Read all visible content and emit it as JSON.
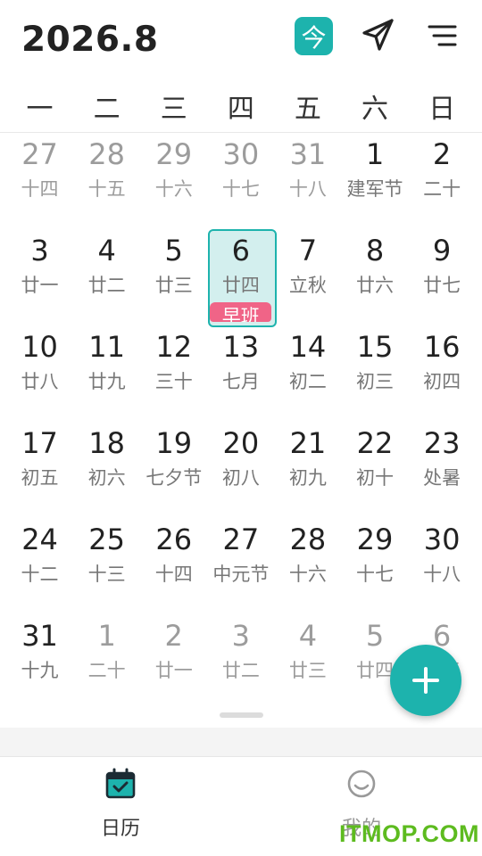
{
  "header": {
    "title": "2026.8",
    "today_label": "今"
  },
  "weekdays": [
    "一",
    "二",
    "三",
    "四",
    "五",
    "六",
    "日"
  ],
  "calendar": {
    "weeks": [
      [
        {
          "day": "27",
          "lunar": "十四",
          "other": true
        },
        {
          "day": "28",
          "lunar": "十五",
          "other": true
        },
        {
          "day": "29",
          "lunar": "十六",
          "other": true
        },
        {
          "day": "30",
          "lunar": "十七",
          "other": true
        },
        {
          "day": "31",
          "lunar": "十八",
          "other": true
        },
        {
          "day": "1",
          "lunar": "建军节"
        },
        {
          "day": "2",
          "lunar": "二十"
        }
      ],
      [
        {
          "day": "3",
          "lunar": "廿一"
        },
        {
          "day": "4",
          "lunar": "廿二"
        },
        {
          "day": "5",
          "lunar": "廿三"
        },
        {
          "day": "6",
          "lunar": "廿四",
          "today": true,
          "badge": "早班"
        },
        {
          "day": "7",
          "lunar": "立秋"
        },
        {
          "day": "8",
          "lunar": "廿六"
        },
        {
          "day": "9",
          "lunar": "廿七"
        }
      ],
      [
        {
          "day": "10",
          "lunar": "廿八"
        },
        {
          "day": "11",
          "lunar": "廿九"
        },
        {
          "day": "12",
          "lunar": "三十"
        },
        {
          "day": "13",
          "lunar": "七月"
        },
        {
          "day": "14",
          "lunar": "初二"
        },
        {
          "day": "15",
          "lunar": "初三"
        },
        {
          "day": "16",
          "lunar": "初四"
        }
      ],
      [
        {
          "day": "17",
          "lunar": "初五"
        },
        {
          "day": "18",
          "lunar": "初六"
        },
        {
          "day": "19",
          "lunar": "七夕节"
        },
        {
          "day": "20",
          "lunar": "初八"
        },
        {
          "day": "21",
          "lunar": "初九"
        },
        {
          "day": "22",
          "lunar": "初十"
        },
        {
          "day": "23",
          "lunar": "处暑"
        }
      ],
      [
        {
          "day": "24",
          "lunar": "十二"
        },
        {
          "day": "25",
          "lunar": "十三"
        },
        {
          "day": "26",
          "lunar": "十四"
        },
        {
          "day": "27",
          "lunar": "中元节"
        },
        {
          "day": "28",
          "lunar": "十六"
        },
        {
          "day": "29",
          "lunar": "十七"
        },
        {
          "day": "30",
          "lunar": "十八"
        }
      ],
      [
        {
          "day": "31",
          "lunar": "十九"
        },
        {
          "day": "1",
          "lunar": "二十",
          "other": true
        },
        {
          "day": "2",
          "lunar": "廿一",
          "other": true
        },
        {
          "day": "3",
          "lunar": "廿二",
          "other": true
        },
        {
          "day": "4",
          "lunar": "廿三",
          "other": true
        },
        {
          "day": "5",
          "lunar": "廿四",
          "other": true
        },
        {
          "day": "6",
          "lunar": "廿五",
          "other": true
        }
      ]
    ]
  },
  "fab": {
    "icon": "plus-icon"
  },
  "tabs": [
    {
      "label": "日历",
      "icon": "calendar-check-icon",
      "active": true
    },
    {
      "label": "我的",
      "icon": "smiley-icon",
      "active": false
    }
  ],
  "watermark": "ITMOP.COM",
  "colors": {
    "accent": "#1db3ad",
    "today_bg": "#d3efee",
    "badge": "#f06487",
    "watermark": "#5dbb1f"
  }
}
